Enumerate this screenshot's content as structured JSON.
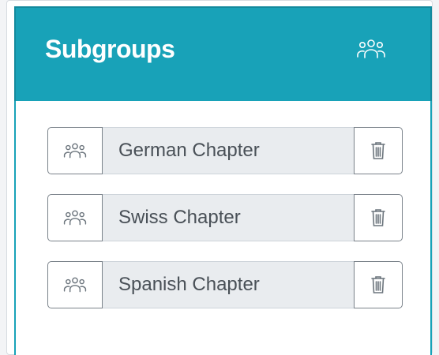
{
  "header": {
    "title": "Subgroups",
    "icon": "users-icon"
  },
  "colors": {
    "header_bg": "#18a2b8",
    "input_bg": "#e9ecef",
    "text": "#495057"
  },
  "subgroups": [
    {
      "name": "German Chapter",
      "icon": "users-icon",
      "action_icon": "trash-icon"
    },
    {
      "name": "Swiss Chapter",
      "icon": "users-icon",
      "action_icon": "trash-icon"
    },
    {
      "name": "Spanish Chapter",
      "icon": "users-icon",
      "action_icon": "trash-icon"
    }
  ]
}
